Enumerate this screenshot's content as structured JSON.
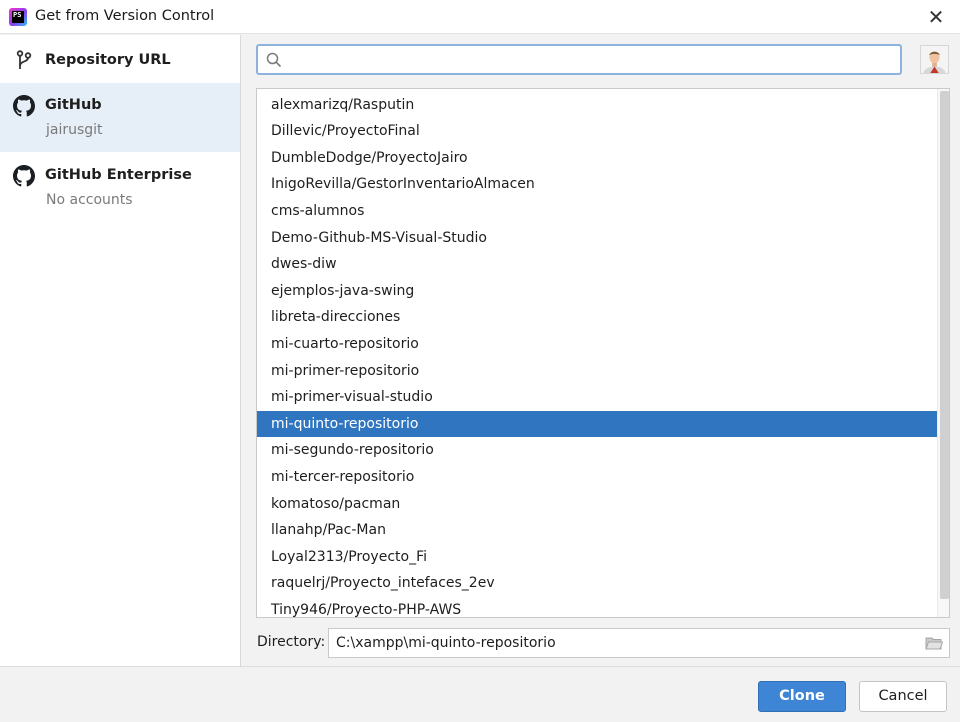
{
  "window": {
    "title": "Get from Version Control",
    "app_icon_text": "PS"
  },
  "sidebar": {
    "items": [
      {
        "label": "Repository URL",
        "sub": "",
        "icon": "branch-icon"
      },
      {
        "label": "GitHub",
        "sub": "jairusgit",
        "icon": "github-icon"
      },
      {
        "label": "GitHub Enterprise",
        "sub": "No accounts",
        "icon": "github-icon"
      }
    ],
    "selected_index": 1
  },
  "search": {
    "value": "",
    "placeholder": ""
  },
  "repositories": {
    "items": [
      "alexmarizq/Rasputin",
      "Dillevic/ProyectoFinal",
      "DumbleDodge/ProyectoJairo",
      "InigoRevilla/GestorInventarioAlmacen",
      "cms-alumnos",
      "Demo-Github-MS-Visual-Studio",
      "dwes-diw",
      "ejemplos-java-swing",
      "libreta-direcciones",
      "mi-cuarto-repositorio",
      "mi-primer-repositorio",
      "mi-primer-visual-studio",
      "mi-quinto-repositorio",
      "mi-segundo-repositorio",
      "mi-tercer-repositorio",
      "komatoso/pacman",
      "llanahp/Pac-Man",
      "Loyal2313/Proyecto_Fi",
      "raquelrj/Proyecto_intefaces_2ev",
      "Tiny946/Proyecto-PHP-AWS"
    ],
    "selected": "mi-quinto-repositorio"
  },
  "directory": {
    "label": "Directory:",
    "value": "C:\\xampp\\mi-quinto-repositorio"
  },
  "buttons": {
    "clone": "Clone",
    "cancel": "Cancel"
  },
  "colors": {
    "selection": "#2f75c0",
    "sidebar_selected": "#e6eef7",
    "primary_button": "#3e86d5",
    "search_focus_border": "#8db2de"
  }
}
